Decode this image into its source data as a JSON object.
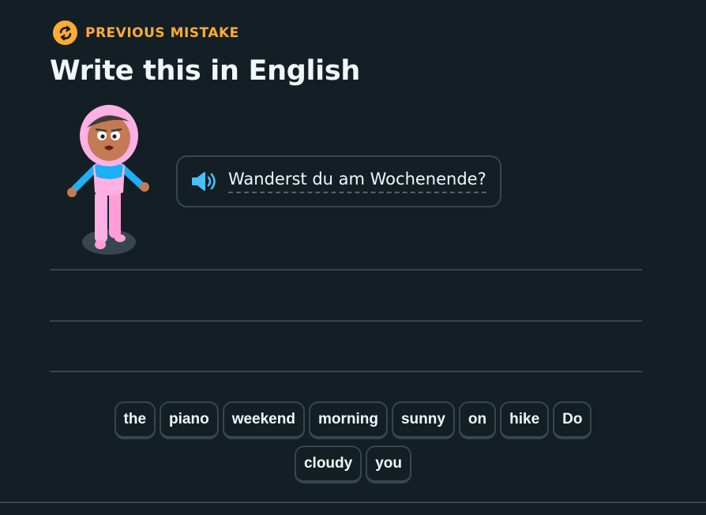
{
  "header": {
    "mistake_icon": "repeat-icon",
    "mistake_label": "PREVIOUS MISTAKE",
    "title": "Write this in English"
  },
  "prompt": {
    "speaker_icon": "speaker-icon",
    "sentence": "Wanderst du am Wochenende?"
  },
  "word_bank": [
    "the",
    "piano",
    "weekend",
    "morning",
    "sunny",
    "on",
    "hike",
    "Do",
    "cloudy",
    "you"
  ],
  "colors": {
    "background": "#131f24",
    "accent_orange": "#ffab33",
    "border": "#37464f",
    "speaker_blue": "#49c0f8"
  }
}
